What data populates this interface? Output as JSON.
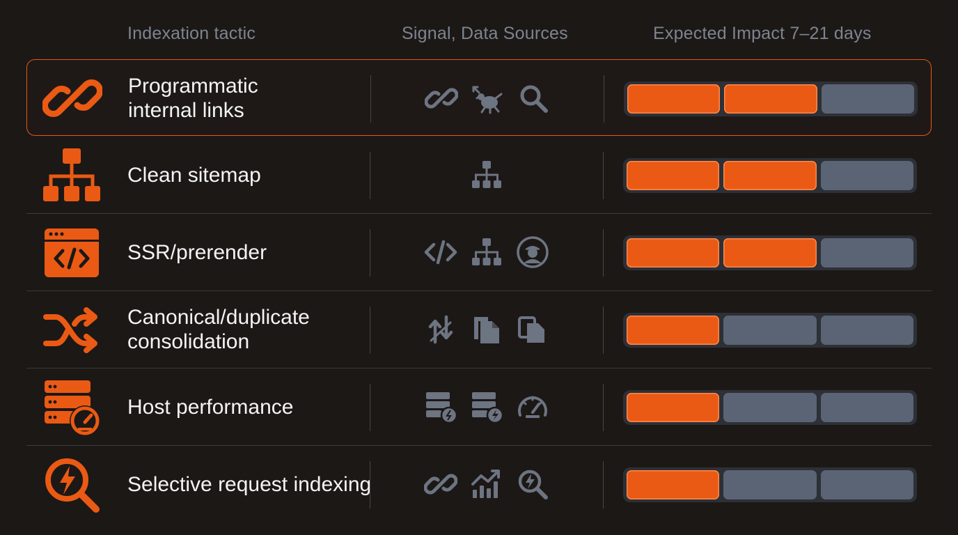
{
  "columns": {
    "tactic": "Indexation tactic",
    "signal": "Signal, Data Sources",
    "impact": "Expected Impact 7–21 days"
  },
  "colors": {
    "accent": "#ea5a14",
    "inactive": "#5a6474",
    "icon_muted": "#6d7482",
    "background": "#1c1816"
  },
  "rows": [
    {
      "label_lines": [
        "Programmatic",
        "internal links"
      ],
      "icon": "chain-link-icon",
      "signals": [
        "link-icon",
        "crawler-bug-icon",
        "search-icon"
      ],
      "impact_level": 2,
      "impact_max": 3,
      "highlighted": true
    },
    {
      "label_lines": [
        "Clean sitemap"
      ],
      "icon": "sitemap-icon",
      "signals": [
        "sitemap-icon"
      ],
      "impact_level": 2,
      "impact_max": 3,
      "highlighted": false
    },
    {
      "label_lines": [
        "SSR/prerender"
      ],
      "icon": "code-window-icon",
      "signals": [
        "code-icon",
        "sitemap-icon",
        "crawler-agent-icon"
      ],
      "impact_level": 2,
      "impact_max": 3,
      "highlighted": false
    },
    {
      "label_lines": [
        "Canonical/duplicate",
        "consolidation"
      ],
      "icon": "shuffle-icon",
      "signals": [
        "swap-arrows-icon",
        "documents-icon",
        "copy-icon"
      ],
      "impact_level": 1,
      "impact_max": 3,
      "highlighted": false
    },
    {
      "label_lines": [
        "Host performance"
      ],
      "icon": "server-gauge-icon",
      "signals": [
        "server-icon",
        "server-bolt-icon",
        "speedometer-icon"
      ],
      "impact_level": 1,
      "impact_max": 3,
      "highlighted": false
    },
    {
      "label_lines": [
        "Selective request indexing"
      ],
      "icon": "bolt-search-icon",
      "signals": [
        "link-icon",
        "trend-chart-icon",
        "bolt-search-icon"
      ],
      "impact_level": 1,
      "impact_max": 3,
      "highlighted": false
    }
  ]
}
